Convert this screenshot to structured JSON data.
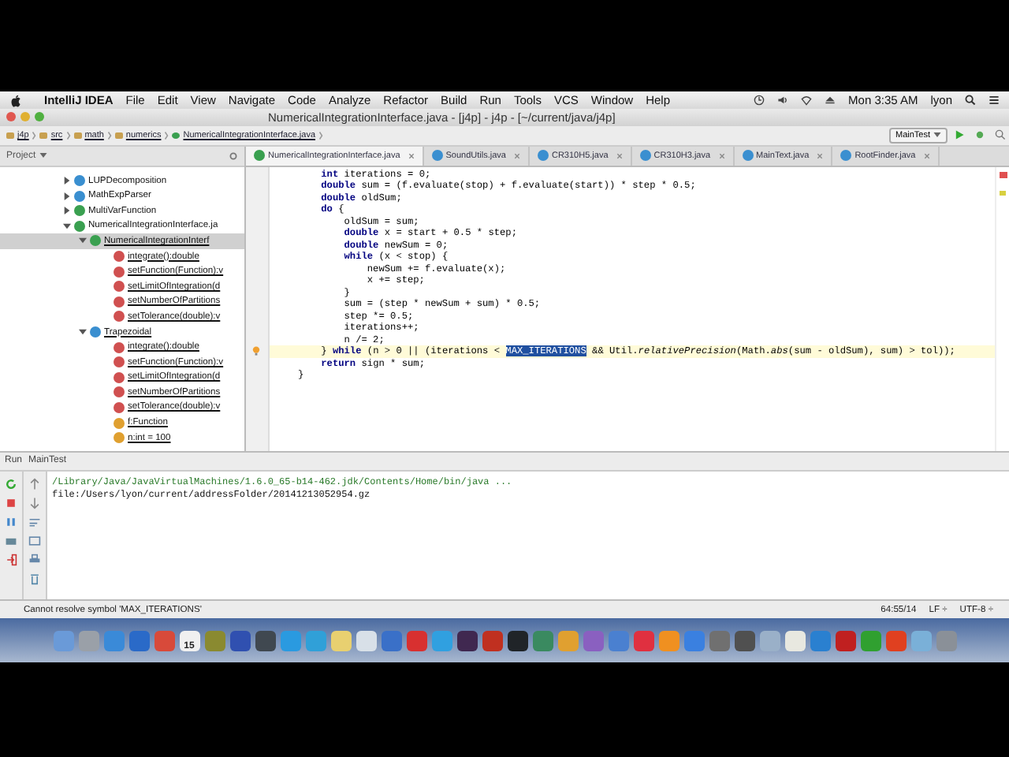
{
  "menubar": {
    "app": "IntelliJ IDEA",
    "menus": [
      "File",
      "Edit",
      "View",
      "Navigate",
      "Code",
      "Analyze",
      "Refactor",
      "Build",
      "Run",
      "Tools",
      "VCS",
      "Window",
      "Help"
    ],
    "clock": "Mon 3:35 AM",
    "user": "lyon"
  },
  "window": {
    "title": "NumericalIntegrationInterface.java - [j4p] - j4p - [~/current/java/j4p]"
  },
  "breadcrumbs": [
    {
      "label": "j4p",
      "kind": "folder"
    },
    {
      "label": "src",
      "kind": "folder"
    },
    {
      "label": "math",
      "kind": "folder"
    },
    {
      "label": "numerics",
      "kind": "folder"
    },
    {
      "label": "NumericalIntegrationInterface.java",
      "kind": "interface"
    }
  ],
  "run_config": "MainTest",
  "project_pane": {
    "title": "Project",
    "tree": [
      {
        "label": "LUPDecomposition",
        "kind": "class",
        "expanded": false,
        "selected": false
      },
      {
        "label": "MathExpParser",
        "kind": "class",
        "expanded": false,
        "selected": false
      },
      {
        "label": "MultiVarFunction",
        "kind": "interface",
        "expanded": false,
        "selected": false
      },
      {
        "label": "NumericalIntegrationInterface.ja",
        "kind": "interface",
        "expanded": true,
        "selected": false,
        "children": [
          {
            "label": "NumericalIntegrationInterf",
            "kind": "interface",
            "expanded": true,
            "selected": true,
            "children": [
              {
                "label": "integrate():double",
                "kind": "abstract-method",
                "selected": false
              },
              {
                "label": "setFunction(Function):v",
                "kind": "abstract-method",
                "selected": false
              },
              {
                "label": "setLimitOfIntegration(d",
                "kind": "abstract-method",
                "selected": false
              },
              {
                "label": "setNumberOfPartitions",
                "kind": "abstract-method",
                "selected": false
              },
              {
                "label": "setTolerance(double):v",
                "kind": "abstract-method",
                "selected": false
              }
            ]
          },
          {
            "label": "Trapezoidal",
            "kind": "class",
            "expanded": true,
            "selected": false,
            "children": [
              {
                "label": "integrate():double",
                "kind": "method",
                "selected": false
              },
              {
                "label": "setFunction(Function):v",
                "kind": "method",
                "selected": false
              },
              {
                "label": "setLimitOfIntegration(d",
                "kind": "method",
                "selected": false
              },
              {
                "label": "setNumberOfPartitions",
                "kind": "method",
                "selected": false
              },
              {
                "label": "setTolerance(double):v",
                "kind": "method",
                "selected": false
              },
              {
                "label": "f:Function",
                "kind": "field",
                "selected": false
              },
              {
                "label": "n:int = 100",
                "kind": "field",
                "selected": false
              }
            ]
          }
        ]
      }
    ]
  },
  "tabs": [
    {
      "label": "NumericalIntegrationInterface.java",
      "kind": "interface",
      "selected": true
    },
    {
      "label": "SoundUtils.java",
      "kind": "class",
      "selected": false
    },
    {
      "label": "CR310H5.java",
      "kind": "class",
      "selected": false
    },
    {
      "label": "CR310H3.java",
      "kind": "class",
      "selected": false
    },
    {
      "label": "MainText.java",
      "kind": "class",
      "selected": false
    },
    {
      "label": "RootFinder.java",
      "kind": "class",
      "selected": false
    }
  ],
  "code": [
    {
      "text": "    **int** iterations = 0;"
    },
    {
      "text": "    **double** sum = (f.evaluate(stop) + f.evaluate(start)) * step * 0.5;"
    },
    {
      "text": "    **double** oldSum;"
    },
    {
      "text": "    **do** {"
    },
    {
      "text": "        oldSum = sum;"
    },
    {
      "text": "        **double** x = start + 0.5 * step;"
    },
    {
      "text": "        **double** newSum = 0;"
    },
    {
      "text": "        **while** (x < stop) {"
    },
    {
      "text": "            newSum += f.evaluate(x);"
    },
    {
      "text": "            x += step;"
    },
    {
      "text": "        }"
    },
    {
      "text": "        sum = (step * newSum + sum) * 0.5;"
    },
    {
      "text": "        step *= 0.5;"
    },
    {
      "text": "        iterations++;"
    },
    {
      "text": "        n /= 2;"
    },
    {
      "text": "    } **while** (n > 0 || (iterations < ",
      "selection": "MAX_ITERATIONS",
      "after": " && Util.*relativePrecision*(Math.*abs*(sum - oldSum), sum) > tol));",
      "current": true
    },
    {
      "text": "    **return** sign * sum;"
    },
    {
      "text": "}"
    }
  ],
  "run_panel": {
    "title": "Run",
    "config": "MainTest",
    "output": [
      {
        "text": "/Library/Java/JavaVirtualMachines/1.6.0_65-b14-462.jdk/Contents/Home/bin/java ...",
        "kind": "command"
      },
      {
        "text": "file:/Users/lyon/current/addressFolder/20141213052954.gz",
        "kind": "output"
      }
    ]
  },
  "status_bar": {
    "message": "Cannot resolve symbol 'MAX_ITERATIONS'",
    "position": "64:55/14",
    "line_separator": "LF ÷",
    "encoding": "UTF-8 ÷"
  },
  "dock": {
    "items": [
      {
        "color": "#6a9ad8"
      },
      {
        "color": "#9aa0a8"
      },
      {
        "color": "#3a8ad8"
      },
      {
        "color": "#2a6ac8"
      },
      {
        "color": "#d84a3a"
      },
      {
        "color": "#f0f0f0",
        "label": "15"
      },
      {
        "color": "#8a8a30"
      },
      {
        "color": "#3050b0"
      },
      {
        "color": "#404850"
      },
      {
        "color": "#2a9ae0"
      },
      {
        "color": "#30a0d8"
      },
      {
        "color": "#e8d070"
      },
      {
        "color": "#d8e0e8"
      },
      {
        "color": "#3a70c8"
      },
      {
        "color": "#d83030"
      },
      {
        "color": "#30a0e0"
      },
      {
        "color": "#402850"
      },
      {
        "color": "#c03020"
      },
      {
        "color": "#202428"
      },
      {
        "color": "#3a8a60"
      },
      {
        "color": "#e0a030"
      },
      {
        "color": "#8a60c0"
      },
      {
        "color": "#4a80d0"
      },
      {
        "color": "#e03040"
      },
      {
        "color": "#f09020"
      },
      {
        "color": "#3a80e0"
      },
      {
        "color": "#707070"
      },
      {
        "color": "#505050"
      },
      {
        "color": "#9ab0c8"
      },
      {
        "color": "#e8e8e0"
      },
      {
        "color": "#2a80d0"
      },
      {
        "color": "#c02020"
      },
      {
        "color": "#30a030"
      },
      {
        "color": "#e04020"
      },
      {
        "color": "#7ab0d8"
      },
      {
        "color": "#8a9098"
      }
    ]
  }
}
